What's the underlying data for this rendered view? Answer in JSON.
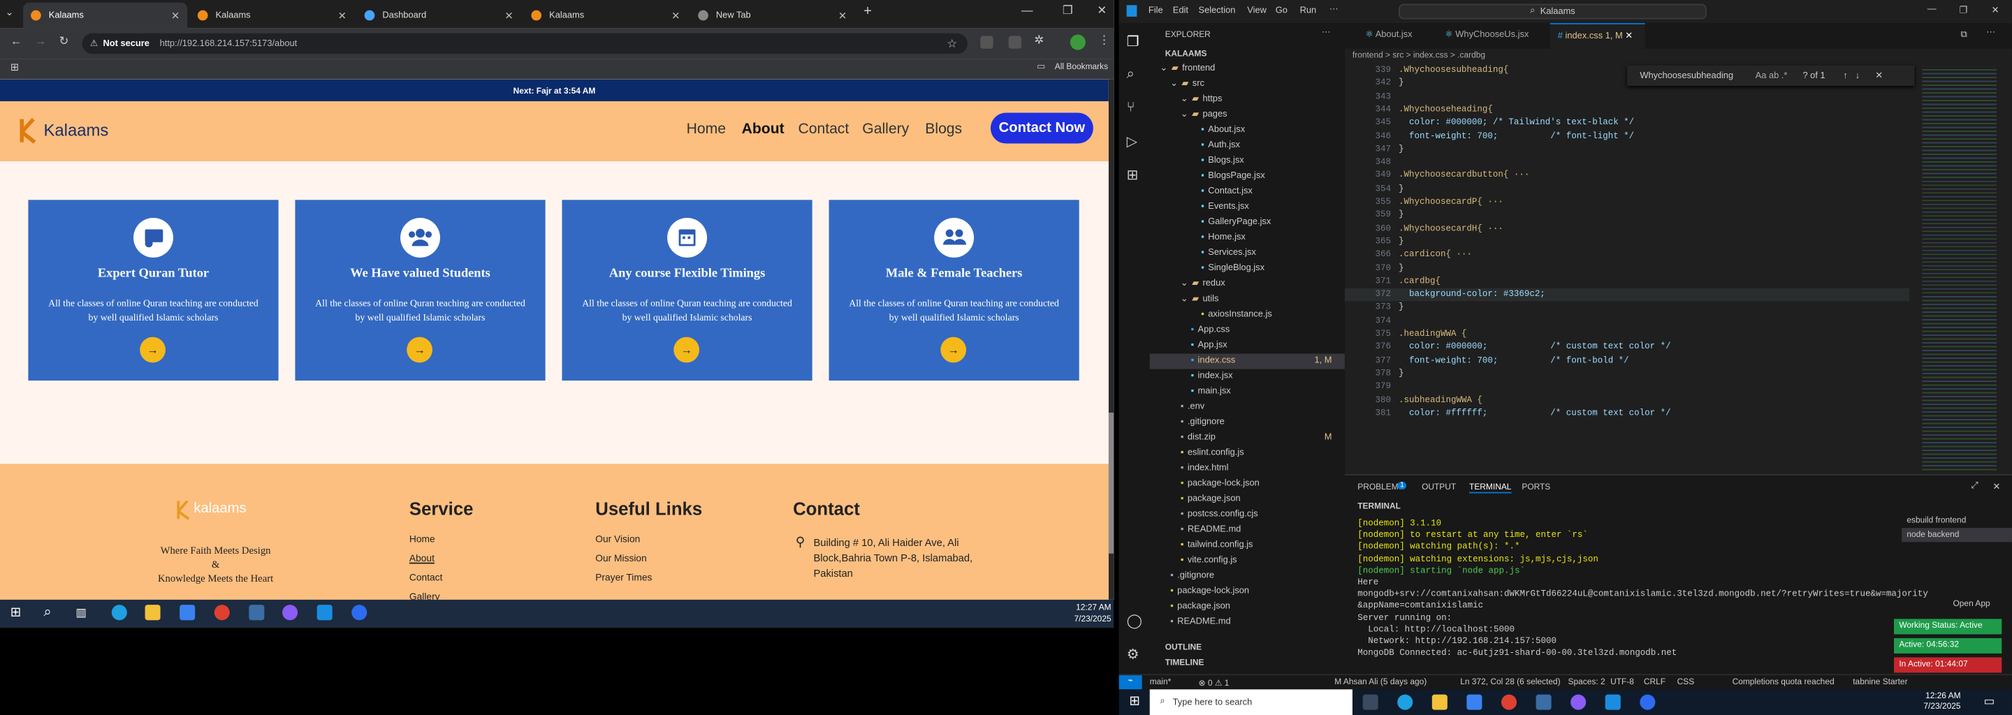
{
  "browser": {
    "tabs": [
      {
        "label": "Kalaams",
        "active": true
      },
      {
        "label": "Kalaams"
      },
      {
        "label": "Dashboard"
      },
      {
        "label": "Kalaams"
      },
      {
        "label": "New Tab"
      }
    ],
    "not_secure": "Not secure",
    "url": "http://192.168.214.157:5173/about",
    "all_bookmarks": "All Bookmarks"
  },
  "site": {
    "prayer": "Next: Fajr at 3:54 AM",
    "logo": "Kalaams",
    "nav": [
      "Home",
      "About",
      "Contact",
      "Gallery",
      "Blogs"
    ],
    "contact_btn": "Contact Now",
    "cards": [
      {
        "title": "Expert Quran Tutor",
        "desc": "All the classes of online Quran teaching are conducted by well qualified Islamic scholars",
        "icon": "tutor-icon"
      },
      {
        "title": "We Have valued Students",
        "desc": "All the classes of online Quran teaching are conducted by well qualified Islamic scholars",
        "icon": "students-icon"
      },
      {
        "title": "Any course Flexible Timings",
        "desc": "All the classes of online Quran teaching are conducted by well qualified Islamic scholars",
        "icon": "calendar-icon"
      },
      {
        "title": "Male & Female Teachers",
        "desc": "All the classes of online Quran teaching are conducted by well qualified Islamic scholars",
        "icon": "teachers-icon"
      }
    ],
    "card_color": "#3369c2",
    "footer": {
      "logo": "kalaams",
      "tagline1": "Where Faith Meets Design",
      "tagline2": "&",
      "tagline3": "Knowledge Meets the Heart",
      "service_title": "Service",
      "service_links": [
        "Home",
        "About",
        "Contact",
        "Gallery"
      ],
      "useful_title": "Useful Links",
      "useful_links": [
        "Our Vision",
        "Our Mission",
        "Prayer Times"
      ],
      "contact_title": "Contact",
      "address": "Building # 10, Ali Haider Ave, Ali Block,Bahria Town P-8, Islamabad, Pakistan"
    }
  },
  "left_clock": {
    "time": "12:27 AM",
    "date": "7/23/2025"
  },
  "vscode": {
    "menu": [
      "File",
      "Edit",
      "Selection",
      "View",
      "Go",
      "Run"
    ],
    "search": "Kalaams",
    "explorer_title": "EXPLORER",
    "project": "KALAAMS",
    "tree": [
      {
        "n": "frontend",
        "d": 1,
        "f": true
      },
      {
        "n": "src",
        "d": 2,
        "f": true
      },
      {
        "n": "https",
        "d": 3,
        "f": true
      },
      {
        "n": "pages",
        "d": 3,
        "f": true
      },
      {
        "n": "About.jsx",
        "d": 4
      },
      {
        "n": "Auth.jsx",
        "d": 4
      },
      {
        "n": "Blogs.jsx",
        "d": 4
      },
      {
        "n": "BlogsPage.jsx",
        "d": 4
      },
      {
        "n": "Contact.jsx",
        "d": 4
      },
      {
        "n": "Events.jsx",
        "d": 4
      },
      {
        "n": "GalleryPage.jsx",
        "d": 4
      },
      {
        "n": "Home.jsx",
        "d": 4
      },
      {
        "n": "Services.jsx",
        "d": 4
      },
      {
        "n": "SingleBlog.jsx",
        "d": 4
      },
      {
        "n": "redux",
        "d": 3,
        "f": true
      },
      {
        "n": "utils",
        "d": 3,
        "f": true
      },
      {
        "n": "axiosInstance.js",
        "d": 4
      },
      {
        "n": "App.css",
        "d": 3
      },
      {
        "n": "App.jsx",
        "d": 3
      },
      {
        "n": "index.css",
        "d": 3,
        "sel": true,
        "badge": "1, M"
      },
      {
        "n": "index.jsx",
        "d": 3
      },
      {
        "n": "main.jsx",
        "d": 3
      },
      {
        "n": ".env",
        "d": 2
      },
      {
        "n": ".gitignore",
        "d": 2
      },
      {
        "n": "dist.zip",
        "d": 2,
        "badge": "M"
      },
      {
        "n": "eslint.config.js",
        "d": 2
      },
      {
        "n": "index.html",
        "d": 2
      },
      {
        "n": "package-lock.json",
        "d": 2
      },
      {
        "n": "package.json",
        "d": 2
      },
      {
        "n": "postcss.config.cjs",
        "d": 2
      },
      {
        "n": "README.md",
        "d": 2
      },
      {
        "n": "tailwind.config.js",
        "d": 2
      },
      {
        "n": "vite.config.js",
        "d": 2
      },
      {
        "n": ".gitignore",
        "d": 1
      },
      {
        "n": "package-lock.json",
        "d": 1
      },
      {
        "n": "package.json",
        "d": 1
      },
      {
        "n": "README.md",
        "d": 1
      }
    ],
    "outline": "OUTLINE",
    "timeline": "TIMELINE",
    "editor_tabs": [
      "About.jsx",
      "WhyChooseUs.jsx",
      "index.css 1, M"
    ],
    "breadcrumb": "frontend > src > index.css > .cardbg",
    "find": {
      "query": "Whychoosesubheading",
      "result": "? of 1"
    },
    "code": [
      {
        "n": "339",
        "t": ".Whychoosesubheading{"
      },
      {
        "n": "342",
        "t": "}"
      },
      {
        "n": "343",
        "t": ""
      },
      {
        "n": "344",
        "t": ".Whychooseheading{"
      },
      {
        "n": "345",
        "t": "  color: #000000; /* Tailwind's text-black */"
      },
      {
        "n": "346",
        "t": "  font-weight: 700;          /* font-light */"
      },
      {
        "n": "347",
        "t": "}"
      },
      {
        "n": "348",
        "t": ""
      },
      {
        "n": "349",
        "t": ".Whychoosecardbutton{ ···"
      },
      {
        "n": "354",
        "t": "}"
      },
      {
        "n": "355",
        "t": ".WhychoosecardP{ ···"
      },
      {
        "n": "359",
        "t": "}"
      },
      {
        "n": "360",
        "t": ".WhychoosecardH{ ···"
      },
      {
        "n": "365",
        "t": "}"
      },
      {
        "n": "366",
        "t": ".cardicon{ ···"
      },
      {
        "n": "370",
        "t": "}"
      },
      {
        "n": "371",
        "t": ".cardbg{"
      },
      {
        "n": "372",
        "t": "  background-color: #3369c2;"
      },
      {
        "n": "373",
        "t": "}"
      },
      {
        "n": "374",
        "t": ""
      },
      {
        "n": "375",
        "t": ".headingWWA {"
      },
      {
        "n": "376",
        "t": "  color: #000000;            /* custom text color */"
      },
      {
        "n": "377",
        "t": "  font-weight: 700;          /* font-bold */"
      },
      {
        "n": "378",
        "t": "}"
      },
      {
        "n": "379",
        "t": ""
      },
      {
        "n": "380",
        "t": ".subheadingWWA {"
      },
      {
        "n": "381",
        "t": "  color: #ffffff;            /* custom text color */"
      }
    ],
    "panel_tabs": [
      "PROBLEMS",
      "OUTPUT",
      "TERMINAL",
      "PORTS"
    ],
    "problems_count": "1",
    "terminal_label": "TERMINAL",
    "terminal": [
      "[nodemon] 3.1.10",
      "[nodemon] to restart at any time, enter `rs`",
      "[nodemon] watching path(s): *.*",
      "[nodemon] watching extensions: js,mjs,cjs,json",
      "[nodemon] starting `node app.js`",
      "Here",
      "mongodb+srv://comtanixahsan:dWKMrGtTd66224uL@comtanixislamic.3tel3zd.mongodb.net/?retryWrites=true&w=majority",
      "&appName=comtanixislamic",
      "Server running on:",
      "  Local: http://localhost:5000",
      "  Network: http://192.168.214.157:5000",
      "MongoDB Connected: ac-6utjz91-shard-00-00.3tel3zd.mongodb.net"
    ],
    "term_list": [
      "esbuild frontend",
      "node backend"
    ],
    "open_app": "Open App",
    "badges": [
      "Working Status: Active",
      "Active: 04:56:32",
      "In Active: 01:44:07"
    ],
    "status_items": [
      "main*",
      "⊗ 0 ⚠ 1",
      "M Ahsan Ali (5 days ago)",
      "Ln 372, Col 28 (6 selected)",
      "Spaces: 2",
      "UTF-8",
      "CRLF",
      "CSS",
      "Completions quota reached",
      "tabnine Starter"
    ]
  },
  "win": {
    "search": "Type here to search",
    "time": "12:26 AM",
    "date": "7/23/2025"
  }
}
